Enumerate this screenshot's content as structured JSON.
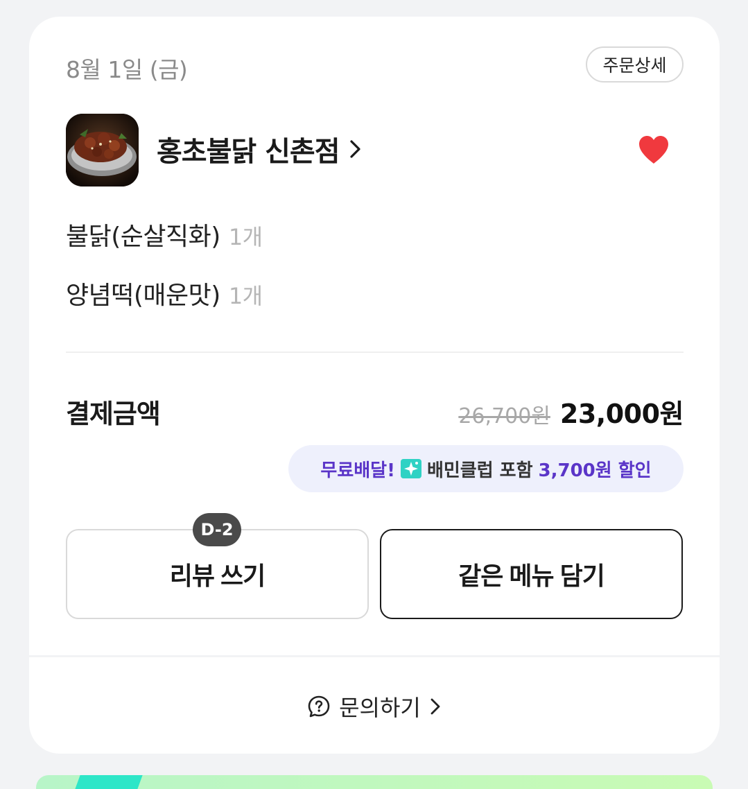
{
  "order": {
    "date": "8월 1일 (금)",
    "detail_button": "주문상세",
    "store_name": "홍초불닭 신촌점",
    "favorited": true,
    "items": [
      {
        "name": "불닭(순살직화)",
        "qty": "1개"
      },
      {
        "name": "양념떡(매운맛)",
        "qty": "1개"
      }
    ],
    "payment_label": "결제금액",
    "original_price": "26,700원",
    "final_price": "23,000원",
    "promo": {
      "free_delivery": "무료배달!",
      "club_text": "배민클럽 포함",
      "discount": "3,700원 할인"
    },
    "review_badge": "D-2",
    "review_button": "리뷰 쓰기",
    "reorder_button": "같은 메뉴 담기",
    "inquiry_label": "문의하기"
  },
  "colors": {
    "accent_purple": "#5a35c8",
    "heart_red": "#f0393e",
    "promo_bg": "#eef0fc",
    "club_icon": "#2fd2c4"
  },
  "icons": [
    "heart-icon",
    "chevron-right-icon",
    "club-sparkle-icon",
    "question-bubble-icon"
  ]
}
